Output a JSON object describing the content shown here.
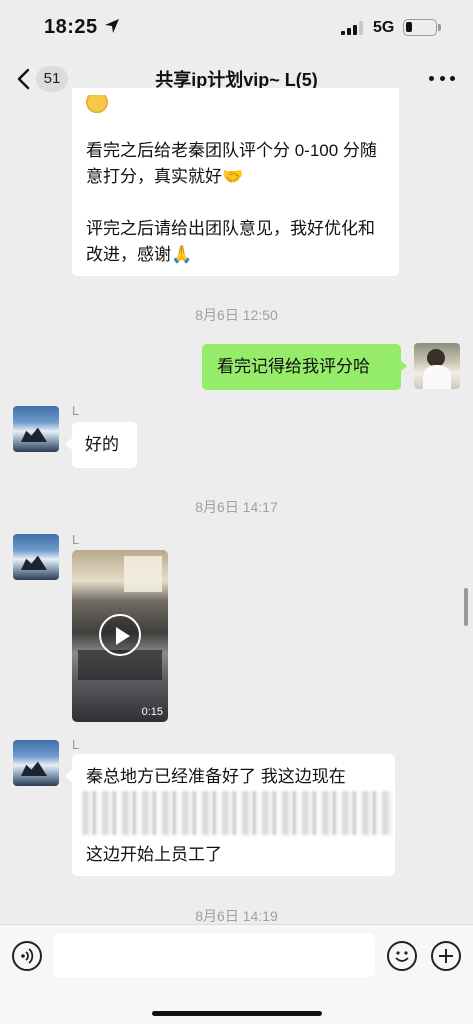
{
  "status_bar": {
    "time": "18:25",
    "network": "5G"
  },
  "nav": {
    "unread_count": "51",
    "title": "共享ip计划vip~ L(5)"
  },
  "messages": {
    "top_bubble_line1": "看完之后给老秦团队评个分 0-100 分随意打分，真实就好🤝",
    "top_bubble_line2": "评完之后请给出团队意见，我好优化和改进，感谢🙏",
    "timestamp_1": "8月6日 12:50",
    "my_message": "看完记得给我评分哈",
    "sender_1": "L",
    "reply_ok": "好的",
    "timestamp_2": "8月6日 14:17",
    "sender_2": "L",
    "video_duration": "0:15",
    "sender_3": "L",
    "long_line1": "秦总地方已经准备好了 我这边现在",
    "long_line4": "这边开始上员工了",
    "timestamp_3": "8月6日 14:19"
  },
  "icons": {
    "location": "location-arrow-icon",
    "signal": "cellular-signal-icon",
    "battery": "battery-icon",
    "back": "chevron-left-icon",
    "more": "more-dots-icon",
    "play": "play-icon",
    "voice": "voice-icon",
    "emoji": "emoji-icon",
    "plus": "plus-icon"
  },
  "colors": {
    "background": "#ededed",
    "my_bubble": "#95ec69",
    "their_bubble": "#ffffff",
    "timestamp": "#a0a0a0"
  }
}
